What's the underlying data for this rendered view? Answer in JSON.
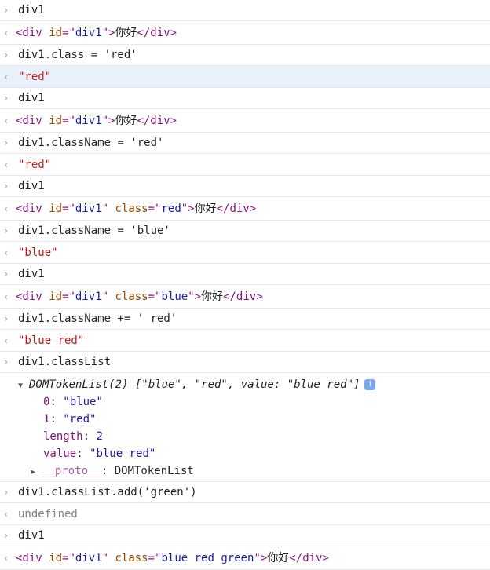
{
  "markers": {
    "input": "›",
    "output": "‹"
  },
  "entries": [
    {
      "cmd": "div1",
      "el": {
        "id": "div1",
        "cls": "",
        "text": "你好"
      }
    },
    {
      "cmd": "div1.class = 'red'",
      "result": "\"red\""
    },
    {
      "cmd": "div1",
      "el": {
        "id": "div1",
        "cls": "",
        "text": "你好"
      }
    },
    {
      "cmd": "div1.className = 'red'",
      "result": "\"red\""
    },
    {
      "cmd": "div1",
      "el": {
        "id": "div1",
        "cls": "red",
        "text": "你好"
      }
    },
    {
      "cmd": "div1.className = 'blue'",
      "result": "\"blue\""
    },
    {
      "cmd": "div1",
      "el": {
        "id": "div1",
        "cls": "blue",
        "text": "你好"
      }
    },
    {
      "cmd": "div1.className += ' red'",
      "result": "\"blue red\""
    },
    {
      "cmd": "div1.classList"
    },
    {
      "cmd": "div1.classList.add('green')",
      "result": "undefined"
    },
    {
      "cmd": "div1",
      "el": {
        "id": "div1",
        "cls": "blue red green",
        "text": "你好"
      }
    }
  ],
  "tokenlist": {
    "head": "DOMTokenList(2) [\"blue\", \"red\", value: \"blue red\"]",
    "info_icon": "i",
    "props": [
      {
        "key": "0",
        "value": "\"blue\""
      },
      {
        "key": "1",
        "value": "\"red\""
      },
      {
        "key": "length",
        "value": "2"
      },
      {
        "key": "value",
        "value": "\"blue red\""
      }
    ],
    "proto_key": "__proto__",
    "proto_value": "DOMTokenList"
  },
  "colors": {
    "string": "#c41a16",
    "tag": "#881280",
    "attr": "#994500",
    "attr_value": "#1a1aa6",
    "highlight": "#e8f0fb"
  }
}
